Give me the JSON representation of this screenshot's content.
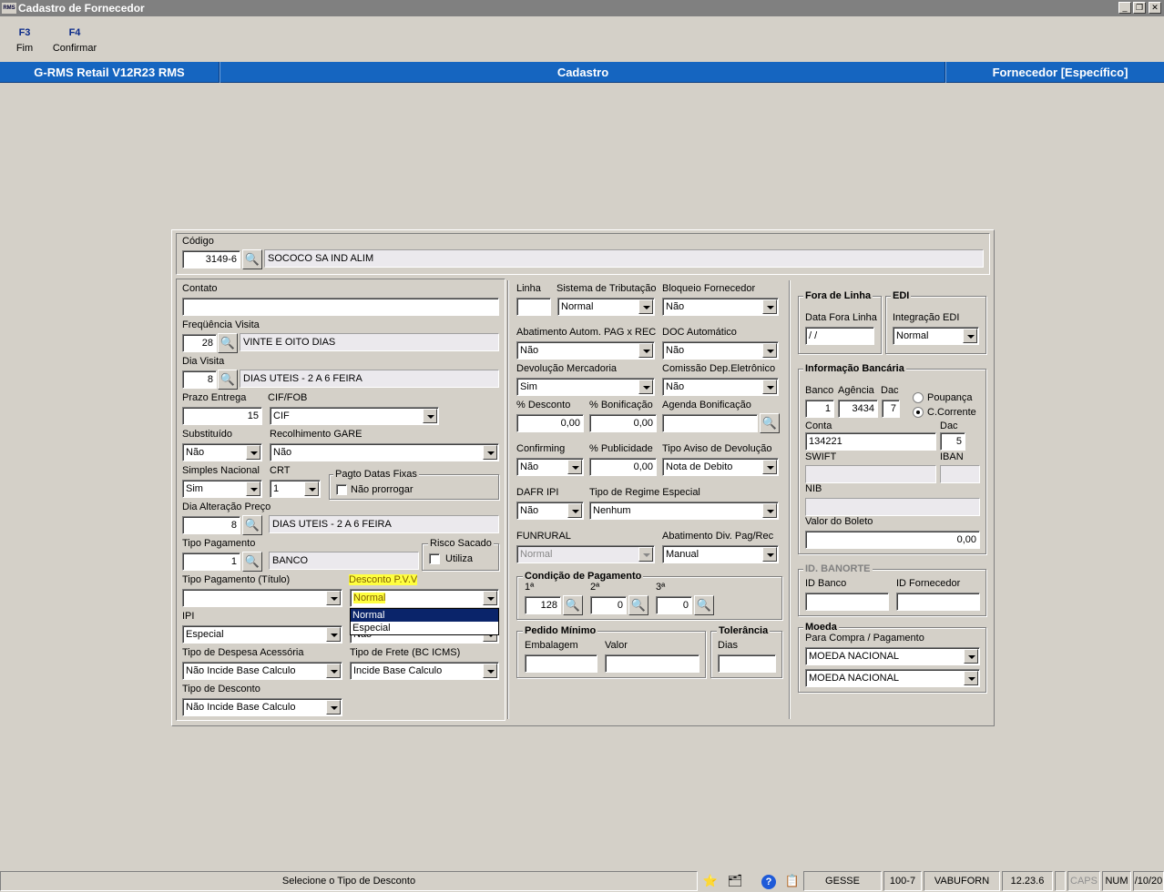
{
  "window": {
    "title": "Cadastro de Fornecedor",
    "app_icon": "rms-icon"
  },
  "fkeys": [
    {
      "key": "F3",
      "label": "Fim"
    },
    {
      "key": "F4",
      "label": "Confirmar"
    }
  ],
  "header": {
    "left": "G-RMS Retail V12R23 RMS",
    "center": "Cadastro",
    "right": "Fornecedor [Específico]"
  },
  "codigo": {
    "label": "Código",
    "value": "3149-6",
    "name": "SOCOCO SA IND ALIM"
  },
  "left": {
    "contato": {
      "label": "Contato",
      "value": ""
    },
    "freq_visita": {
      "label": "Freqüência Visita",
      "value": "28",
      "desc": "VINTE E OITO DIAS"
    },
    "dia_visita": {
      "label": "Dia Visita",
      "value": "8",
      "desc": "DIAS UTEIS -  2  A  6 FEIRA"
    },
    "prazo_entrega": {
      "label": "Prazo Entrega",
      "value": "15"
    },
    "cif_fob": {
      "label": "CIF/FOB",
      "value": "CIF"
    },
    "substituido": {
      "label": "Substituído",
      "value": "Não"
    },
    "recolhimento_gare": {
      "label": "Recolhimento GARE",
      "value": "Não"
    },
    "simples_nacional": {
      "label": "Simples Nacional",
      "value": "Sim"
    },
    "crt": {
      "label": "CRT",
      "value": "1"
    },
    "pagto_datas_fixas": {
      "legend": "Pagto Datas Fixas",
      "checkbox_label": "Não prorrogar"
    },
    "dia_alteracao_preco": {
      "label": "Dia Alteração Preço",
      "value": "8",
      "desc": "DIAS UTEIS -  2  A  6 FEIRA"
    },
    "tipo_pagamento": {
      "label": "Tipo Pagamento",
      "value": "1",
      "desc": "BANCO"
    },
    "risco_sacado": {
      "legend": "Risco Sacado",
      "checkbox_label": "Utiliza"
    },
    "tipo_pagamento_titulo": {
      "label": "Tipo Pagamento (Título)",
      "value": ""
    },
    "desconto_pvv": {
      "label": "Desconto P.V.V",
      "value": "Normal",
      "options": [
        "Normal",
        "Especial"
      ],
      "selected_index": 0
    },
    "ipi": {
      "label": "IPI",
      "value": "Especial"
    },
    "hidden_combo_value": "Não",
    "tipo_despesa": {
      "label": "Tipo de Despesa Acessória",
      "value": "Não Incide Base Calculo"
    },
    "tipo_frete": {
      "label": "Tipo de Frete (BC ICMS)",
      "value": "Incide Base Calculo"
    },
    "tipo_desconto": {
      "label": "Tipo de Desconto",
      "value": "Não Incide Base Calculo"
    }
  },
  "middle": {
    "linha": {
      "label": "Linha",
      "value": ""
    },
    "sistema_tributacao": {
      "label": "Sistema de Tributação",
      "value": "Normal"
    },
    "bloqueio_fornecedor": {
      "label": "Bloqueio Fornecedor",
      "value": "Não"
    },
    "abatimento_autom": {
      "label": "Abatimento Autom. PAG x REC",
      "value": "Não"
    },
    "doc_automatico": {
      "label": "DOC Automático",
      "value": "Não"
    },
    "devolucao_mercadoria": {
      "label": "Devolução Mercadoria",
      "value": "Sim"
    },
    "comissao_dep": {
      "label": "Comissão Dep.Eletrônico",
      "value": "Não"
    },
    "pct_desconto": {
      "label": "% Desconto",
      "value": "0,00"
    },
    "pct_bonificacao": {
      "label": "% Bonificação",
      "value": "0,00"
    },
    "agenda_bonificacao": {
      "label": "Agenda Bonificação",
      "value": ""
    },
    "confirming": {
      "label": "Confirming",
      "value": "Não"
    },
    "pct_publicidade": {
      "label": "% Publicidade",
      "value": "0,00"
    },
    "tipo_aviso_devolucao": {
      "label": "Tipo Aviso de Devolução",
      "value": "Nota de Debito"
    },
    "dafr_ipi": {
      "label": "DAFR IPI",
      "value": "Não"
    },
    "tipo_regime_especial": {
      "label": "Tipo de Regime Especial",
      "value": "Nenhum"
    },
    "funrural": {
      "label": "FUNRURAL",
      "value": "Normal"
    },
    "abatimento_div": {
      "label": "Abatimento Div. Pag/Rec",
      "value": "Manual"
    },
    "condicao_pagamento": {
      "legend": "Condição de Pagamento",
      "labels": [
        "1ª",
        "2ª",
        "3ª"
      ],
      "values": [
        "128",
        "0",
        "0"
      ]
    },
    "pedido_minimo": {
      "legend": "Pedido Mínimo",
      "embalagem_label": "Embalagem",
      "valor_label": "Valor",
      "embalagem": "",
      "valor": ""
    },
    "tolerancia": {
      "legend": "Tolerância",
      "dias_label": "Dias",
      "dias": ""
    }
  },
  "right": {
    "fora_de_linha": {
      "legend": "Fora de Linha",
      "label": "Data Fora Linha",
      "value": " /  /"
    },
    "edi": {
      "legend": "EDI",
      "label": "Integração EDI",
      "value": "Normal"
    },
    "info_bancaria": {
      "legend": "Informação Bancária",
      "banco_label": "Banco",
      "banco": "1",
      "agencia_label": "Agência",
      "agencia": "3434",
      "dac_label": "Dac",
      "dac": "7",
      "poupanca_label": "Poupança",
      "ccorrente_label": "C.Corrente",
      "account_type": "C.Corrente",
      "conta_label": "Conta",
      "conta": "134221",
      "dac2_label": "Dac",
      "dac2": "5",
      "swift_label": "SWIFT",
      "swift": "",
      "iban_label": "IBAN",
      "iban": "",
      "nib_label": "NIB",
      "nib": "",
      "valor_boleto_label": "Valor do Boleto",
      "valor_boleto": "0,00"
    },
    "banorte": {
      "legend": "ID. BANORTE",
      "id_banco_label": "ID Banco",
      "id_fornecedor_label": "ID Fornecedor",
      "id_banco": "",
      "id_fornecedor": ""
    },
    "moeda": {
      "legend": "Moeda",
      "label": "Para Compra / Pagamento",
      "value1": "MOEDA NACIONAL",
      "value2": "MOEDA NACIONAL"
    }
  },
  "statusbar": {
    "message": "Selecione o Tipo de Desconto",
    "user": "GESSE",
    "code": "100-7",
    "host": "VABUFORN",
    "version": "12.23.6",
    "caps": "CAPS",
    "num": "NUM",
    "date": "/10/20",
    "icons": [
      "star-icon",
      "user-card-icon",
      "help-icon",
      "clipboard-icon"
    ]
  }
}
